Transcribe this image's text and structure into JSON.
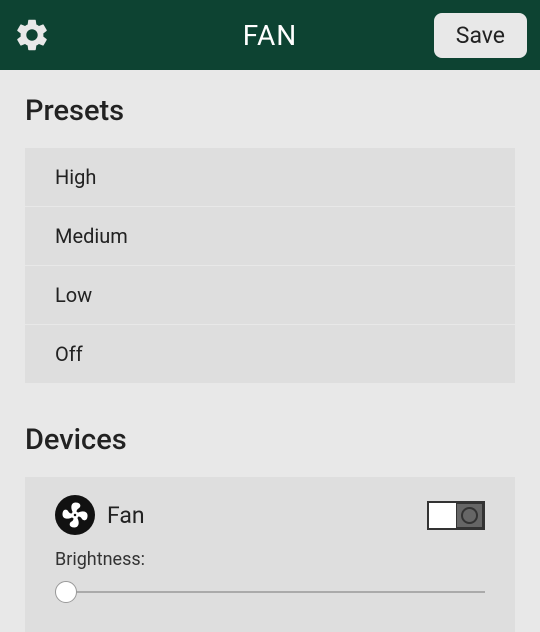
{
  "header": {
    "title": "FAN",
    "save_label": "Save"
  },
  "sections": {
    "presets_title": "Presets",
    "devices_title": "Devices"
  },
  "presets": [
    {
      "label": "High"
    },
    {
      "label": "Medium"
    },
    {
      "label": "Low"
    },
    {
      "label": "Off"
    }
  ],
  "device": {
    "name": "Fan",
    "brightness_label": "Brightness:",
    "toggle_state": "off",
    "brightness_value": 0
  }
}
